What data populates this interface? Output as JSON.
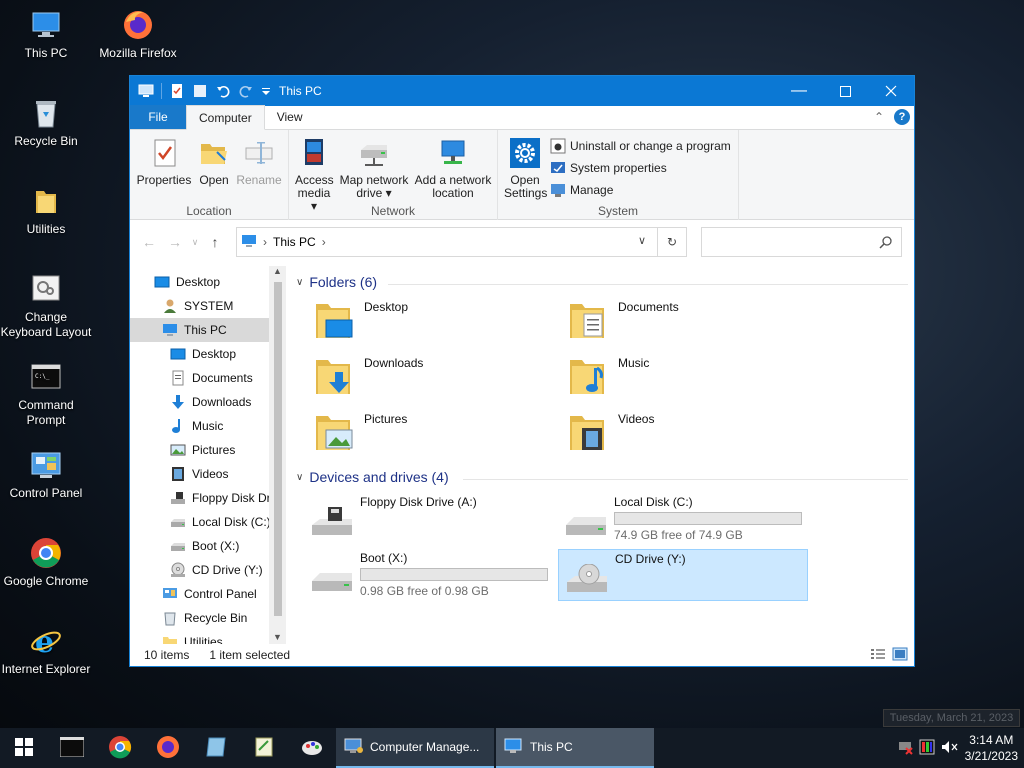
{
  "desktop": {
    "icons": [
      {
        "label": "This PC",
        "icon": "this-pc-icon"
      },
      {
        "label": "Mozilla Firefox",
        "icon": "firefox-icon"
      },
      {
        "label": "Recycle Bin",
        "icon": "recycle-bin-icon"
      },
      {
        "label": "Utilities",
        "icon": "folder-icon"
      },
      {
        "label": "Change Keyboard Layout",
        "icon": "keyboard-icon"
      },
      {
        "label": "Command Prompt",
        "icon": "command-prompt-icon"
      },
      {
        "label": "Control Panel",
        "icon": "control-panel-icon"
      },
      {
        "label": "Google Chrome",
        "icon": "chrome-icon"
      },
      {
        "label": "Internet Explorer",
        "icon": "internet-explorer-icon"
      }
    ]
  },
  "window": {
    "title": "This PC",
    "tabs": {
      "file": "File",
      "computer": "Computer",
      "view": "View"
    },
    "ribbon": {
      "location": {
        "label": "Location",
        "properties": "Properties",
        "open": "Open",
        "rename": "Rename"
      },
      "network": {
        "label": "Network",
        "access_media_1": "Access",
        "access_media_2": "media",
        "map_drive_1": "Map network",
        "map_drive_2": "drive",
        "add_location_1": "Add a network",
        "add_location_2": "location"
      },
      "system": {
        "label": "System",
        "open_settings_1": "Open",
        "open_settings_2": "Settings",
        "uninstall": "Uninstall or change a program",
        "system_properties": "System properties",
        "manage": "Manage"
      }
    },
    "address": {
      "crumb": "This PC",
      "search_placeholder": ""
    },
    "nav_pane": [
      {
        "label": "Desktop",
        "icon": "desktop-icon",
        "indent": 0
      },
      {
        "label": "SYSTEM",
        "icon": "user-icon",
        "indent": 1
      },
      {
        "label": "This PC",
        "icon": "this-pc-icon",
        "indent": 1,
        "selected": true
      },
      {
        "label": "Desktop",
        "icon": "desktop-icon",
        "indent": 2
      },
      {
        "label": "Documents",
        "icon": "documents-icon",
        "indent": 2
      },
      {
        "label": "Downloads",
        "icon": "downloads-icon",
        "indent": 2
      },
      {
        "label": "Music",
        "icon": "music-icon",
        "indent": 2
      },
      {
        "label": "Pictures",
        "icon": "pictures-icon",
        "indent": 2
      },
      {
        "label": "Videos",
        "icon": "videos-icon",
        "indent": 2
      },
      {
        "label": "Floppy Disk Dri",
        "icon": "floppy-icon",
        "indent": 2
      },
      {
        "label": "Local Disk (C:)",
        "icon": "drive-icon",
        "indent": 2
      },
      {
        "label": "Boot (X:)",
        "icon": "drive-icon",
        "indent": 2
      },
      {
        "label": "CD Drive (Y:)",
        "icon": "cd-icon",
        "indent": 2
      },
      {
        "label": "Control Panel",
        "icon": "control-panel-icon",
        "indent": 1
      },
      {
        "label": "Recycle Bin",
        "icon": "recycle-bin-icon",
        "indent": 1
      },
      {
        "label": "Utilities",
        "icon": "folder-icon",
        "indent": 1
      }
    ],
    "folders": {
      "header": "Folders (6)",
      "items": [
        {
          "label": "Desktop",
          "icon": "desktop-folder-icon"
        },
        {
          "label": "Documents",
          "icon": "documents-folder-icon"
        },
        {
          "label": "Downloads",
          "icon": "downloads-folder-icon"
        },
        {
          "label": "Music",
          "icon": "music-folder-icon"
        },
        {
          "label": "Pictures",
          "icon": "pictures-folder-icon"
        },
        {
          "label": "Videos",
          "icon": "videos-folder-icon"
        }
      ]
    },
    "drives": {
      "header": "Devices and drives (4)",
      "items": [
        {
          "label": "Floppy Disk Drive (A:)",
          "icon": "floppy-drive-icon",
          "free": "",
          "used_fraction": null
        },
        {
          "label": "Local Disk (C:)",
          "icon": "hard-drive-icon",
          "free": "74.9 GB free of 74.9 GB",
          "used_fraction": 0.0
        },
        {
          "label": "Boot (X:)",
          "icon": "hard-drive-icon",
          "free": "0.98 GB free of 0.98 GB",
          "used_fraction": 0.0
        },
        {
          "label": "CD Drive (Y:)",
          "icon": "cd-drive-icon",
          "free": "",
          "used_fraction": null,
          "selected": true
        }
      ]
    },
    "status": {
      "items": "10 items",
      "selected": "1 item selected"
    }
  },
  "taskbar": {
    "apps": [
      {
        "label": "Computer Manage...",
        "icon": "computer-management-icon"
      },
      {
        "label": "This PC",
        "icon": "file-explorer-icon",
        "active": true
      }
    ],
    "time": "3:14 AM",
    "date": "3/21/2023",
    "tooltip": "Tuesday, March 21, 2023"
  },
  "colors": {
    "accent": "#0b78d4",
    "selection": "#cce8ff",
    "header_text": "#1e3287"
  }
}
